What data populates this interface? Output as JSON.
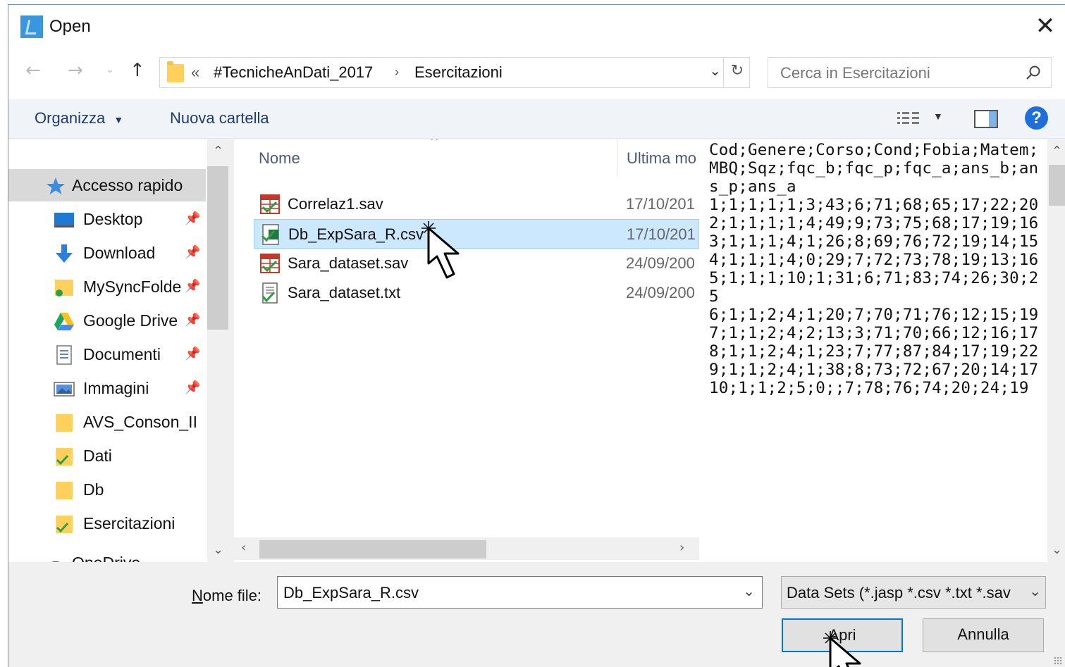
{
  "window": {
    "title": "Open"
  },
  "address": {
    "overflow": "«",
    "crumbs": [
      "#TecnicheAnDati_2017",
      "Esercitazioni"
    ]
  },
  "search": {
    "placeholder": "Cerca in Esercitazioni"
  },
  "toolbar": {
    "organize": "Organizza",
    "new_folder": "Nuova cartella"
  },
  "sidebar": {
    "items": [
      {
        "label": "Accesso rapido",
        "icon": "star-icon"
      },
      {
        "label": "Desktop",
        "icon": "desktop-icon",
        "pinned": true
      },
      {
        "label": "Download",
        "icon": "download-icon",
        "pinned": true
      },
      {
        "label": "MySyncFolde",
        "icon": "folder-icon",
        "pinned": true
      },
      {
        "label": "Google Drive",
        "icon": "google-drive-icon",
        "pinned": true
      },
      {
        "label": "Documenti",
        "icon": "documents-icon",
        "pinned": true
      },
      {
        "label": "Immagini",
        "icon": "pictures-icon",
        "pinned": true
      },
      {
        "label": "AVS_Conson_II",
        "icon": "folder-icon"
      },
      {
        "label": "Dati",
        "icon": "folder-check-icon"
      },
      {
        "label": "Db",
        "icon": "folder-icon"
      },
      {
        "label": "Esercitazioni",
        "icon": "folder-check-icon"
      },
      {
        "label": "OneDrive",
        "icon": "onedrive-icon"
      }
    ]
  },
  "files": {
    "columns": {
      "name": "Nome",
      "modified": "Ultima mo"
    },
    "rows": [
      {
        "name": "Correlaz1.sav",
        "date": "17/10/201",
        "icon": "sav-file-icon"
      },
      {
        "name": "Db_ExpSara_R.csv",
        "date": "17/10/201",
        "icon": "csv-file-icon",
        "selected": true
      },
      {
        "name": "Sara_dataset.sav",
        "date": "24/09/200",
        "icon": "sav-file-icon"
      },
      {
        "name": "Sara_dataset.txt",
        "date": "24/09/200",
        "icon": "txt-file-icon"
      }
    ]
  },
  "preview": {
    "text": "Cod;Genere;Corso;Cond;Fobia;Matem;MBQ;Sqz;fqc_b;fqc_p;fqc_a;ans_b;ans_p;ans_a\n1;1;1;1;1;3;43;6;71;68;65;17;22;20\n2;1;1;1;1;4;49;9;73;75;68;17;19;16\n3;1;1;1;4;1;26;8;69;76;72;19;14;15\n4;1;1;1;4;0;29;7;72;73;78;19;13;16\n5;1;1;1;10;1;31;6;71;83;74;26;30;25\n6;1;1;2;4;1;20;7;70;71;76;12;15;19\n7;1;1;2;4;2;13;3;71;70;66;12;16;17\n8;1;1;2;4;1;23;7;77;87;84;17;19;22\n9;1;1;2;4;1;38;8;73;72;67;20;14;17\n10;1;1;2;5;0;;7;78;76;74;20;24;19"
  },
  "footer": {
    "filename_label_u": "N",
    "filename_label_rest": "ome file:",
    "filename_value": "Db_ExpSara_R.csv",
    "filetype": "Data Sets (*.jasp *.csv *.txt *.sav",
    "open_button": "Apri",
    "cancel_button": "Annulla"
  },
  "colors": {
    "accent": "#0078d7",
    "selection": "#cce8ff",
    "help": "#1e6fd9",
    "folder": "#ffd15c"
  }
}
